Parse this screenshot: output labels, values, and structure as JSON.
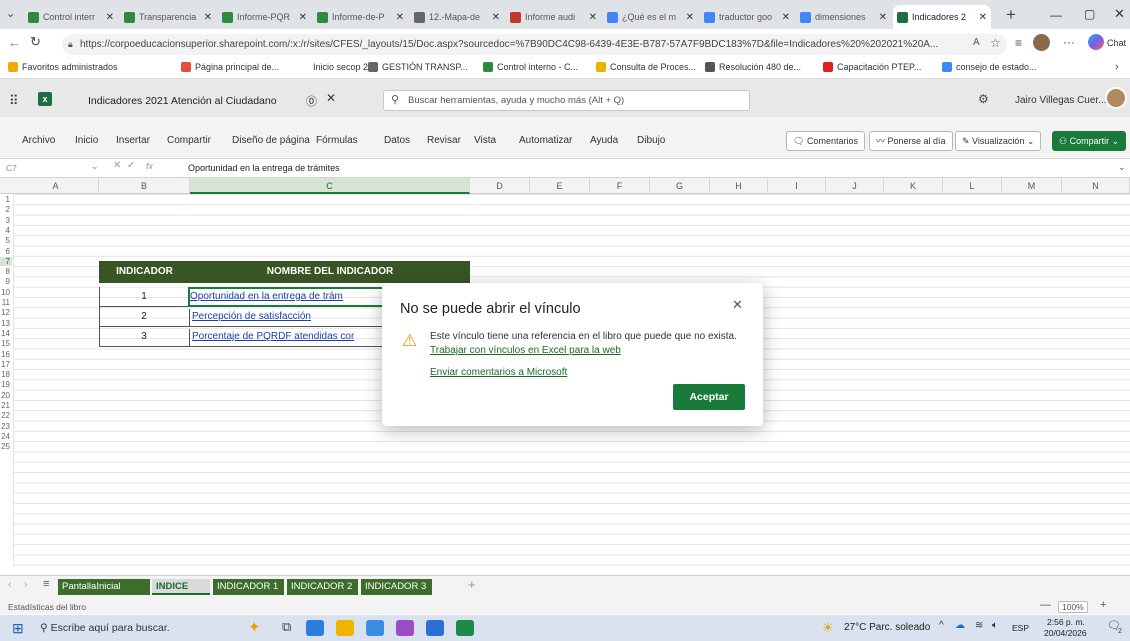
{
  "browser": {
    "tabs": [
      {
        "label": "Control interr",
        "color": "#2e8a3e"
      },
      {
        "label": "Transparencia",
        "color": "#2e8a3e"
      },
      {
        "label": "Informe-PQR",
        "color": "#2e8a3e"
      },
      {
        "label": "Informe-de-P",
        "color": "#2e8a3e"
      },
      {
        "label": "12.-Mapa-de",
        "color": "#666666"
      },
      {
        "label": "Informe audi",
        "color": "#c0392b"
      },
      {
        "label": "¿Qué es el m",
        "color": "#4285f4"
      },
      {
        "label": "traductor goo",
        "color": "#4285f4"
      },
      {
        "label": "dimensiones",
        "color": "#4285f4"
      },
      {
        "label": "Indicadores 2",
        "color": "#1d6f42"
      }
    ],
    "url": "https://corpoeducacionsuperior.sharepoint.com/:x:/r/sites/CFES/_layouts/15/Doc.aspx?sourcedoc=%7B90DC4C98-6439-4E3E-B787-57A7F9BDC183%7D&file=Indicadores%20%202021%20A...",
    "chat_label": "Chat",
    "bookmarks": [
      "Favoritos administrados",
      "Página principal de...",
      "Inicio secop 2",
      "GESTIÓN TRANSP...",
      "Control interno - C...",
      "Consulta de Proces...",
      "Resolución 480 de...",
      "Capacitación PTEP...",
      "consejo de estado..."
    ]
  },
  "excel": {
    "doc_title": "Indicadores 2021 Atención al Ciudadano",
    "search_placeholder": "Buscar herramientas, ayuda y mucho más (Alt + Q)",
    "user_name": "Jairo Villegas Cuer...",
    "menu": [
      "Archivo",
      "Inicio",
      "Insertar",
      "Compartir",
      "Diseño de página",
      "Fórmulas",
      "Datos",
      "Revisar",
      "Vista",
      "Automatizar",
      "Ayuda",
      "Dibujo"
    ],
    "right_buttons": {
      "comments": "Comentarios",
      "catch_up": "Ponerse al día",
      "view": "Visualización",
      "share": "Compartir"
    },
    "name_box": "C7",
    "formula": "Oportunidad en la entrega de trámites",
    "columns": [
      "A",
      "B",
      "C",
      "D",
      "E",
      "F",
      "G",
      "H",
      "I",
      "J",
      "K",
      "L",
      "M",
      "N"
    ],
    "rows": [
      "1",
      "2",
      "3",
      "4",
      "5",
      "6",
      "7",
      "8",
      "9",
      "10",
      "11",
      "12",
      "13",
      "14",
      "15",
      "16",
      "17",
      "18",
      "19",
      "20",
      "21",
      "22",
      "23",
      "24",
      "25"
    ],
    "table": {
      "header_indicator": "INDICADOR",
      "header_name": "NOMBRE DEL INDICADOR",
      "header_color": "#375623",
      "rows": [
        {
          "num": "1",
          "name": "Oportunidad en la entrega de trám"
        },
        {
          "num": "2",
          "name": "Percepción de satisfacción"
        },
        {
          "num": "3",
          "name": "Porcentaje de PQRDF atendidas cor"
        }
      ]
    },
    "sheets": [
      "PantallaInicial",
      "INDICE",
      "INDICADOR 1",
      "INDICADOR 2",
      "INDICADOR 3"
    ],
    "active_sheet": "INDICE",
    "status_left": "Estadísticas del libro",
    "zoom": "100%"
  },
  "dialog": {
    "title": "No se puede abrir el vínculo",
    "message": "Este vínculo tiene una referencia en el libro que puede que no exista.",
    "link_help": "Trabajar con vínculos en Excel para la web",
    "link_feedback": "Enviar comentarios a Microsoft",
    "ok_button": "Aceptar",
    "accent": "#1a7a3a"
  },
  "taskbar": {
    "search_placeholder": "Escribe aquí para buscar.",
    "weather": "27°C  Parc. soleado",
    "lang": "ESP",
    "time": "2:56 p. m.",
    "date": "20/04/2026",
    "notif_count": "2"
  }
}
